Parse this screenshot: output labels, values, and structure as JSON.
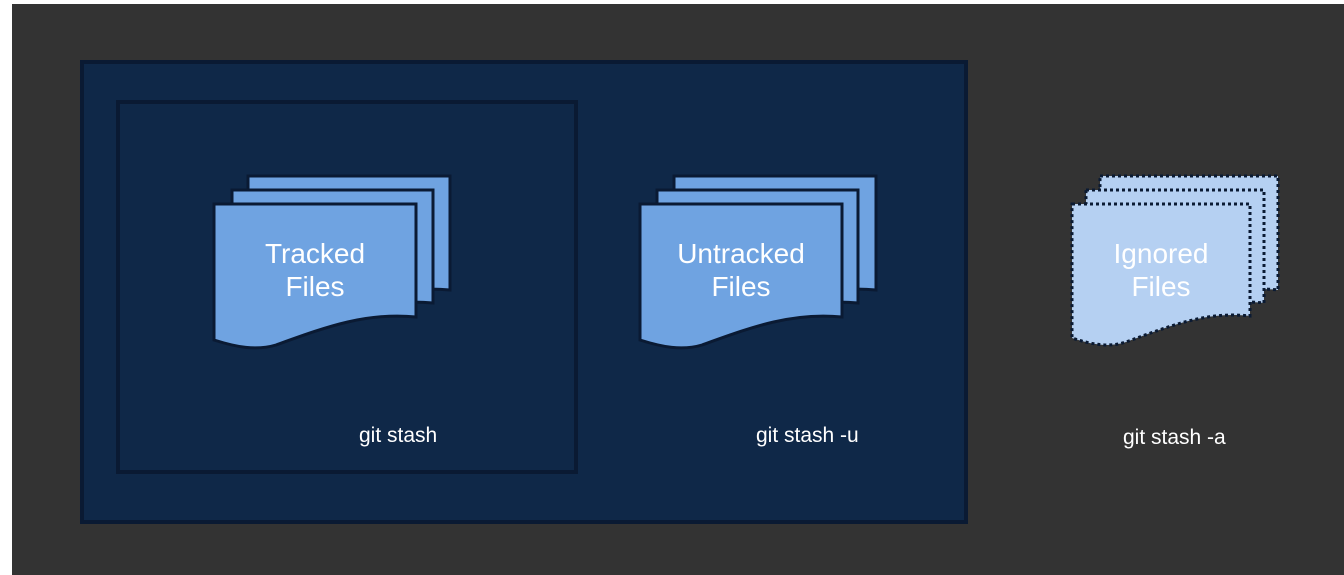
{
  "diagram": {
    "colors": {
      "outer_background": "#333333",
      "container_fill": "#0f2848",
      "container_border": "#0a1a33",
      "doc_fill": "#6fa3e1",
      "doc_stroke": "#0a1a33",
      "ignored_fill": "#b5d0f2",
      "text": "#ffffff"
    },
    "groups": [
      {
        "id": "tracked",
        "label_line1": "Tracked",
        "label_line2": "Files",
        "command": "git stash",
        "icon": "stacked-documents-icon"
      },
      {
        "id": "untracked",
        "label_line1": "Untracked",
        "label_line2": "Files",
        "command": "git stash -u",
        "icon": "stacked-documents-icon"
      },
      {
        "id": "ignored",
        "label_line1": "Ignored",
        "label_line2": "Files",
        "command": "git stash -a",
        "icon": "stacked-documents-dotted-icon"
      }
    ]
  }
}
